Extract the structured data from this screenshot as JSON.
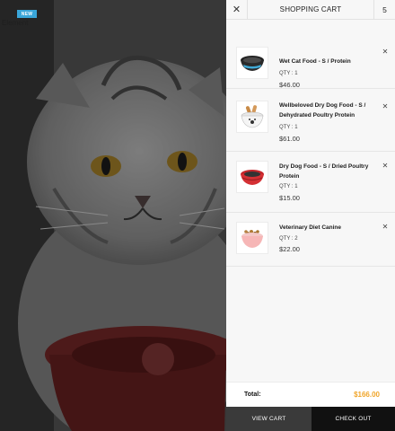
{
  "hero": {
    "badge": "NEW",
    "element_label": "Element"
  },
  "cart": {
    "title": "SHOPPING CART",
    "count": "5",
    "close_icon": "close-icon",
    "items": [
      {
        "name": "Wet Cat Food - S / Protein",
        "qty": "QTY : 1",
        "price": "$46.00",
        "thumb_icon": "black-blue-pet-bowl"
      },
      {
        "name": "Wellbeloved Dry Dog Food - S / Dehydrated Poultry Protein",
        "qty": "QTY : 1",
        "price": "$61.00",
        "thumb_icon": "white-paw-bowl-with-treats"
      },
      {
        "name": "Dry Dog Food - S / Dried Poultry Protein",
        "qty": "QTY : 1",
        "price": "$15.00",
        "thumb_icon": "red-pet-bowl"
      },
      {
        "name": "Veterinary Diet Canine",
        "qty": "QTY : 2",
        "price": "$22.00",
        "thumb_icon": "pink-bowl-with-kibble"
      }
    ],
    "total_label": "Total:",
    "total_value": "$166.00",
    "view_cart": "VIEW CART",
    "checkout": "CHECK OUT"
  },
  "colors": {
    "accent_total": "#f0a52a",
    "badge": "#3aa6d9",
    "view_cart_bg": "#3a3a3a",
    "checkout_bg": "#111111"
  }
}
